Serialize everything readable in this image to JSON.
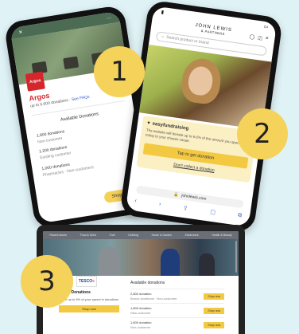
{
  "phone1": {
    "brand": "Argos",
    "subtitle": "up to 6,600 donations",
    "link": "See FAQs",
    "section_title": "Available Donations",
    "donations": [
      {
        "label": "1,800 donations",
        "meta": "Non-customer"
      },
      {
        "label": "1,200 donations",
        "meta": "Existing customer"
      },
      {
        "label": "1,000 donations",
        "meta": "Pharmacies · Non-customers"
      }
    ],
    "cta": "Shop now"
  },
  "phone2": {
    "header": "JOHN LEWIS",
    "header_small": "& PARTNERS",
    "search_placeholder": "Search product or brand",
    "card_title": "easyfundraising",
    "card_body": "The website will donate up to 6.6% of the amount you spend today to your chosen cause.",
    "cta": "Tap to get donation",
    "secondary": "Don't collect a donation",
    "url": "johnlewis.com"
  },
  "laptop": {
    "nav": [
      "Recent stores",
      "Food & Drink",
      "Fuel",
      "Clothing",
      "Home & Garden",
      "Electronics",
      "Health & Beauty"
    ],
    "logo_main": "TESCO",
    "left_title": "Tesco Donations",
    "left_sub": "Raise up to 5% of your spend in donations",
    "left_button": "Shop now",
    "right_title": "Available donations",
    "rows": [
      {
        "label": "2,800 donation",
        "meta": "Bonus donations · Non-customer",
        "button": "Shop now"
      },
      {
        "label": "1,800 donation",
        "meta": "New customer",
        "button": "Shop now"
      },
      {
        "label": "1,600 donation",
        "meta": "Non-customer",
        "button": "Shop now"
      }
    ]
  },
  "badges": {
    "one": "1",
    "two": "2",
    "three": "3"
  },
  "colors": {
    "accent_yellow": "#f5d25a",
    "argos_red": "#d4262b",
    "background": "#dff2f6"
  }
}
